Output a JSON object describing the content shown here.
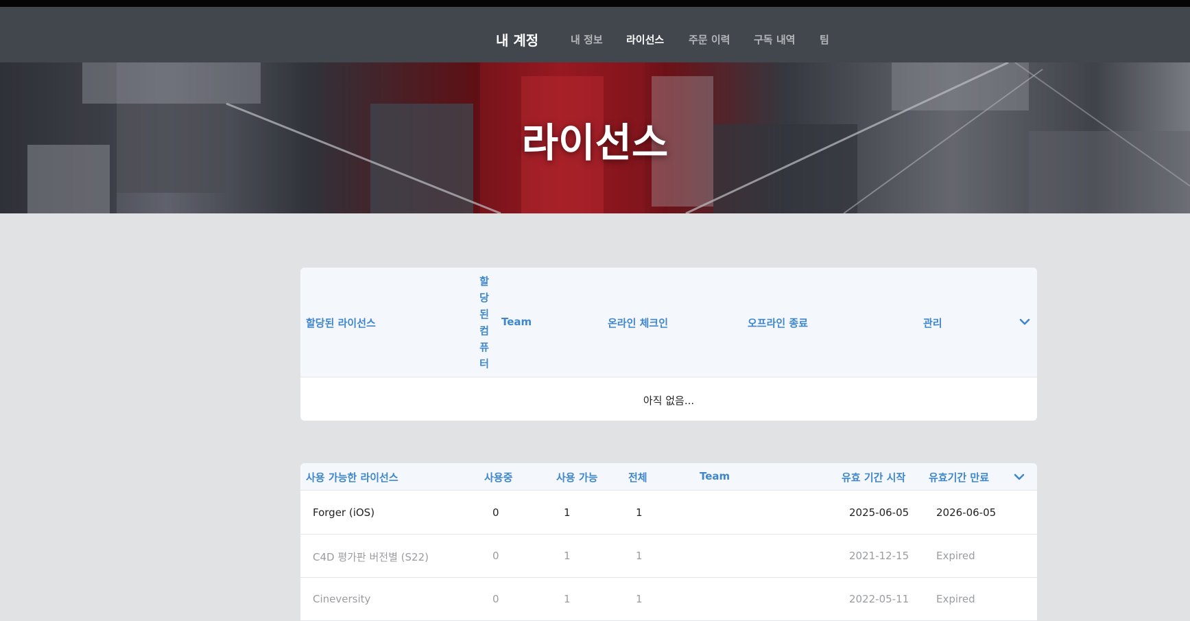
{
  "nav": {
    "brand": "내 계정",
    "links": [
      {
        "label": "내 정보",
        "active": false
      },
      {
        "label": "라이선스",
        "active": true
      },
      {
        "label": "주문 이력",
        "active": false
      },
      {
        "label": "구독 내역",
        "active": false
      },
      {
        "label": "팀",
        "active": false
      }
    ]
  },
  "hero": {
    "title": "라이선스"
  },
  "assigned": {
    "headers": {
      "name": "할당된 라이선스",
      "computer": "할당된컴퓨터",
      "team": "Team",
      "online": "온라인 체크인",
      "offline": "오프라인 종료",
      "manage": "관리"
    },
    "empty_text": "아직 없음..."
  },
  "available": {
    "headers": {
      "name": "사용 가능한 라이선스",
      "in_use": "사용중",
      "available": "사용 가능",
      "total": "전체",
      "team": "Team",
      "start": "유효 기간 시작",
      "end": "유효기간 만료"
    },
    "rows": [
      {
        "name": "Forger (iOS)",
        "in_use": "0",
        "available": "1",
        "total": "1",
        "team": "",
        "start": "2025-06-05",
        "end": "2026-06-05",
        "expired": false
      },
      {
        "name": "C4D 평가판 버전별 (S22)",
        "in_use": "0",
        "available": "1",
        "total": "1",
        "team": "",
        "start": "2021-12-15",
        "end": "Expired",
        "expired": true
      },
      {
        "name": "Cineversity",
        "in_use": "0",
        "available": "1",
        "total": "1",
        "team": "",
        "start": "2022-05-11",
        "end": "Expired",
        "expired": true
      }
    ]
  },
  "icons": {
    "collapse_assigned": "chevron-down-icon",
    "collapse_available": "chevron-down-icon"
  },
  "colors": {
    "navbar": "#41474d",
    "header_text": "#3f86cb",
    "page_bg": "#e1e2e4"
  }
}
